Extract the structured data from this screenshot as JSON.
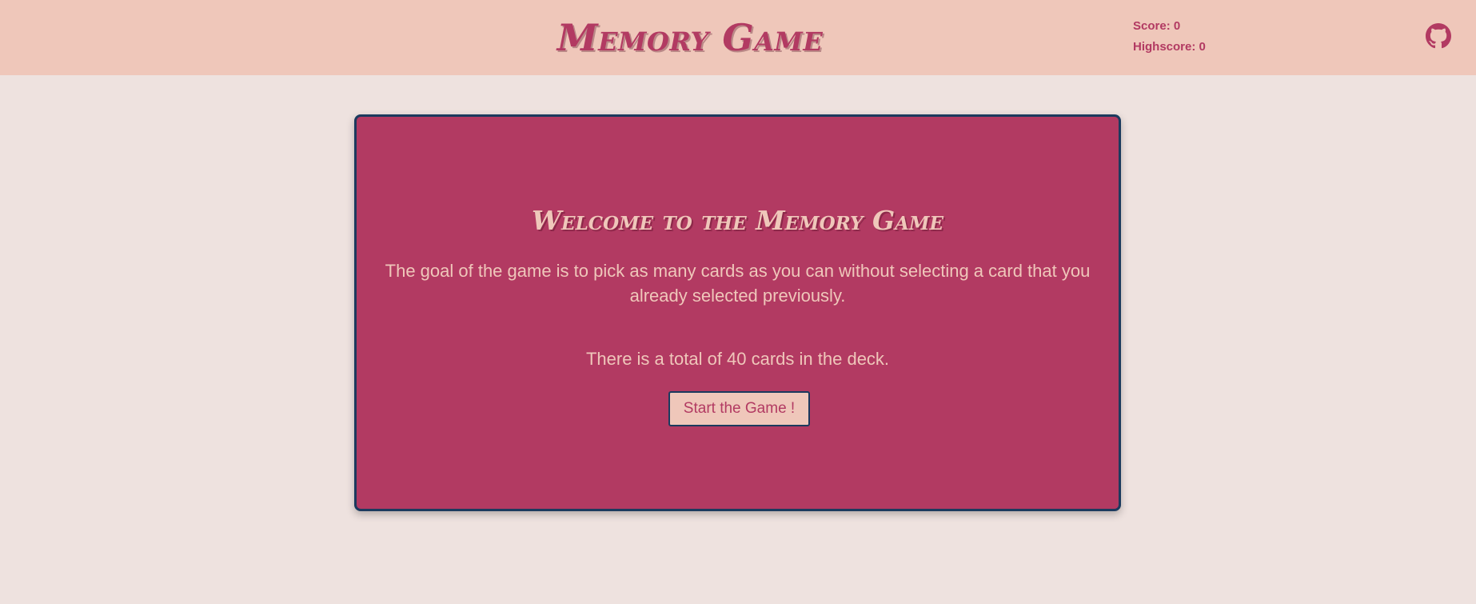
{
  "header": {
    "title": "Memory Game",
    "score_label": "Score: 0",
    "highscore_label": "Highscore: 0",
    "github_icon": "github-icon"
  },
  "intro": {
    "heading": "Welcome to the Memory Game",
    "description": "The goal of the game is to pick as many cards as you can without selecting a card that you already selected previously.",
    "total_text": "There is a total of 40 cards in the deck.",
    "start_button_label": "Start the Game !"
  },
  "colors": {
    "page_background": "#EEE2DF",
    "header_background": "#EFC7BA",
    "accent": "#B23A62",
    "panel_border": "#1B3A5E",
    "panel_text": "#EFC7BA"
  }
}
